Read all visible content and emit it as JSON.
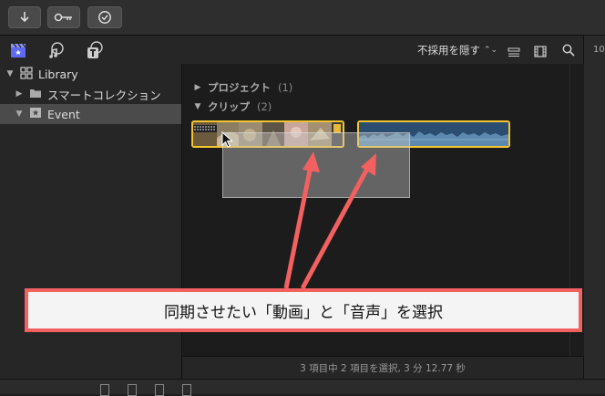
{
  "toolbar": {
    "buttons": [
      {
        "icon": "import-arrow-icon"
      },
      {
        "icon": "key-icon"
      },
      {
        "icon": "check-circle-icon"
      }
    ]
  },
  "subbar": {
    "tabs": [
      {
        "icon": "clapper-board-icon",
        "active": true
      },
      {
        "icon": "music-notes-icon"
      },
      {
        "icon": "titles-icon"
      }
    ],
    "filter_label": "不採用を隠す",
    "right_edge_text": "10"
  },
  "sidebar": {
    "library": "Library",
    "smart_collections": "スマートコレクション",
    "event": "Event"
  },
  "browser": {
    "projects_label": "プロジェクト",
    "projects_count": "(1)",
    "clips_label": "クリップ",
    "clips_count": "(2)"
  },
  "status": "3 項目中 2 項目を選択, 3 分 12.77 秒",
  "annotation": "同期させたい「動画」と「音声」を選択",
  "colors": {
    "selection": "#f4c431",
    "accent": "#5f6af2",
    "callout_border": "#f26060",
    "arrow": "#f26060",
    "audio": "#2a4d70"
  }
}
